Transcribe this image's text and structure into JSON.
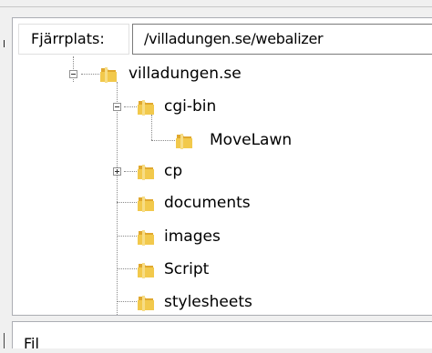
{
  "location": {
    "label": "Fjärrplats:",
    "value": "/villadungen.se/webalizer"
  },
  "tree": {
    "root": {
      "label": "villadungen.se",
      "expanded": true
    },
    "children": [
      {
        "label": "cgi-bin",
        "expanded": true,
        "children": [
          {
            "label": "MoveLawn"
          }
        ]
      },
      {
        "label": "cp",
        "expanded": false
      },
      {
        "label": "documents"
      },
      {
        "label": "images"
      },
      {
        "label": "Script"
      },
      {
        "label": "stylesheets"
      }
    ]
  },
  "bottom_panel": {
    "label": "Fil"
  },
  "colors": {
    "folder_front": "#f2c94c",
    "folder_back": "#e0a82e",
    "tree_line": "#8a8a8a"
  }
}
